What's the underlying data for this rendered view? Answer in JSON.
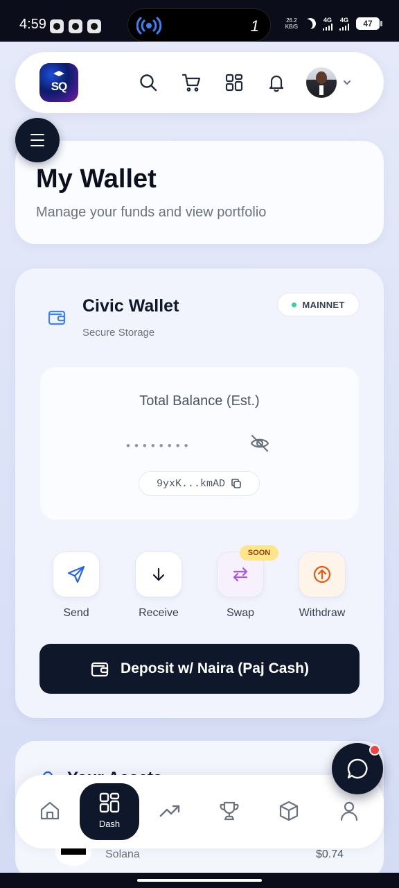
{
  "status_bar": {
    "time": "4:59",
    "island_count": "1",
    "net_speed_value": "26.2",
    "net_speed_unit": "KB/S",
    "network1": "4G",
    "network2": "4G",
    "battery": "47"
  },
  "header": {
    "logo_text": "SQ"
  },
  "title_card": {
    "title": "My Wallet",
    "subtitle": "Manage your funds and view portfolio"
  },
  "wallet": {
    "name": "Civic Wallet",
    "subtitle": "Secure Storage",
    "network_badge": "MAINNET",
    "balance_label": "Total Balance (Est.)",
    "balance_masked": "••••••••",
    "address": "9yxK...kmAD"
  },
  "actions": {
    "send": "Send",
    "receive": "Receive",
    "swap": "Swap",
    "swap_badge": "SOON",
    "withdraw": "Withdraw"
  },
  "deposit_label": "Deposit w/ Naira (Paj Cash)",
  "assets": {
    "title": "Your Assets",
    "items": [
      {
        "name": "Solana",
        "value": "$0.74"
      }
    ]
  },
  "bottom_nav": {
    "active_label": "Dash"
  },
  "colors": {
    "primary_dark": "#0f172a",
    "accent_blue": "#2563eb",
    "mainnet_green": "#34d399",
    "swap_purple": "#a855f7",
    "withdraw_orange": "#ea580c",
    "notification_red": "#ef4444"
  },
  "icons": {
    "header": [
      "search-icon",
      "cart-icon",
      "grid-icon",
      "bell-icon",
      "chevron-down-icon"
    ],
    "actions": [
      "send-icon",
      "receive-arrow-icon",
      "swap-icon",
      "withdraw-icon"
    ],
    "bottom_nav": [
      "home-icon",
      "dashboard-icon",
      "trending-icon",
      "trophy-icon",
      "box-icon",
      "user-icon"
    ]
  }
}
